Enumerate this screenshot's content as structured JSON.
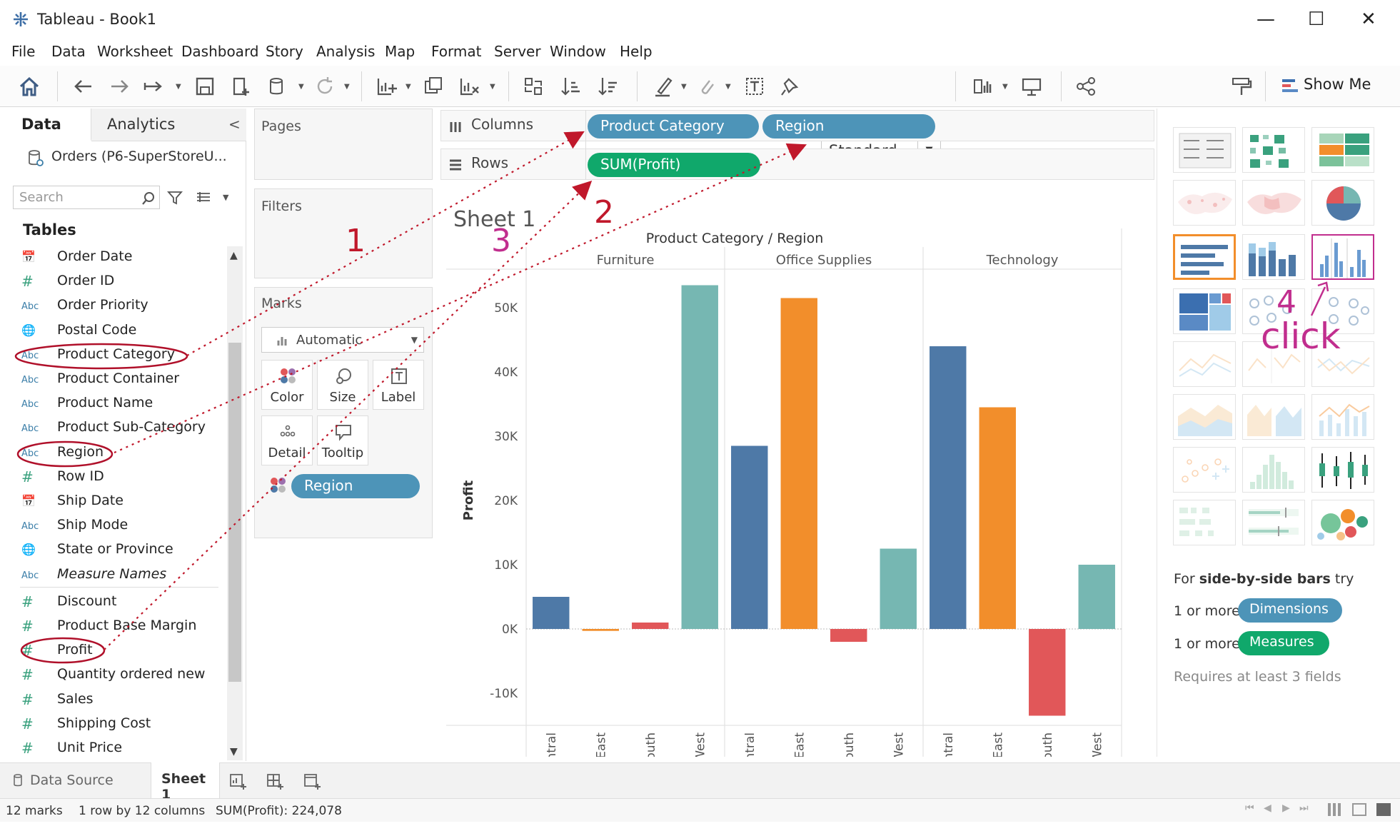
{
  "window": {
    "title": "Tableau - Book1",
    "min": "—",
    "max": "☐",
    "close": "✕"
  },
  "menu": [
    "File",
    "Data",
    "Worksheet",
    "Dashboard",
    "Story",
    "Analysis",
    "Map",
    "Format",
    "Server",
    "Window",
    "Help"
  ],
  "toolbar": {
    "fit_value": "Standard",
    "show_me_label": "Show Me"
  },
  "data_pane": {
    "tab_data": "Data",
    "tab_analytics": "Analytics",
    "collapse": "<",
    "datasource": "Orders (P6-SuperStoreU...",
    "search_placeholder": "Search",
    "tables_heading": "Tables",
    "fields": [
      {
        "type": "date",
        "icon": "📅",
        "name": "Order Date"
      },
      {
        "type": "num",
        "icon": "#",
        "name": "Order ID"
      },
      {
        "type": "str",
        "icon": "Abc",
        "name": "Order Priority"
      },
      {
        "type": "geo",
        "icon": "🌐",
        "name": "Postal Code"
      },
      {
        "type": "str",
        "icon": "Abc",
        "name": "Product Category"
      },
      {
        "type": "str",
        "icon": "Abc",
        "name": "Product Container"
      },
      {
        "type": "str",
        "icon": "Abc",
        "name": "Product Name"
      },
      {
        "type": "str",
        "icon": "Abc",
        "name": "Product Sub-Category"
      },
      {
        "type": "str",
        "icon": "Abc",
        "name": "Region"
      },
      {
        "type": "num",
        "icon": "#",
        "name": "Row ID"
      },
      {
        "type": "date",
        "icon": "📅",
        "name": "Ship Date"
      },
      {
        "type": "str",
        "icon": "Abc",
        "name": "Ship Mode"
      },
      {
        "type": "geo",
        "icon": "🌐",
        "name": "State or Province"
      },
      {
        "type": "str",
        "icon": "Abc",
        "name": "Measure Names"
      },
      {
        "type": "num",
        "icon": "#",
        "name": "Discount"
      },
      {
        "type": "num",
        "icon": "#",
        "name": "Product Base Margin"
      },
      {
        "type": "num",
        "icon": "#",
        "name": "Profit"
      },
      {
        "type": "num",
        "icon": "#",
        "name": "Quantity ordered new"
      },
      {
        "type": "num",
        "icon": "#",
        "name": "Sales"
      },
      {
        "type": "num",
        "icon": "#",
        "name": "Shipping Cost"
      },
      {
        "type": "num",
        "icon": "#",
        "name": "Unit Price"
      }
    ]
  },
  "cards": {
    "pages": "Pages",
    "filters": "Filters",
    "marks": "Marks",
    "mark_type": "Automatic",
    "buttons": [
      "Color",
      "Size",
      "Label",
      "Detail",
      "Tooltip"
    ],
    "marks_pill": "Region"
  },
  "shelves": {
    "columns_label": "Columns",
    "rows_label": "Rows",
    "columns_pills": [
      "Product Category",
      "Region"
    ],
    "rows_pills": [
      "SUM(Profit)"
    ]
  },
  "sheet": {
    "title": "Sheet 1"
  },
  "annotations": {
    "a1": "1",
    "a2": "2",
    "a3": "3",
    "a4": "4",
    "click": "click"
  },
  "chart_data": {
    "type": "bar",
    "header": "Product Category / Region",
    "panes": [
      "Furniture",
      "Office Supplies",
      "Technology"
    ],
    "categories": [
      "Central",
      "East",
      "South",
      "West"
    ],
    "ylabel": "Profit",
    "ylim": [
      -15000,
      55000
    ],
    "yticks": [
      -10000,
      0,
      10000,
      20000,
      30000,
      40000,
      50000
    ],
    "ytick_labels": [
      "-10K",
      "0K",
      "10K",
      "20K",
      "30K",
      "40K",
      "50K"
    ],
    "colors": {
      "Central": "#4e79a7",
      "East": "#f28e2b",
      "South": "#e15759",
      "West": "#76b7b2"
    },
    "values": [
      [
        5000,
        -300,
        1000,
        53500
      ],
      [
        28500,
        51500,
        -2000,
        12500
      ],
      [
        44000,
        34500,
        -13500,
        10000
      ]
    ]
  },
  "show_me": {
    "hint_prefix": "For ",
    "hint_bold": "side-by-side bars",
    "hint_suffix": " try",
    "one_or_more_1": "1 or more",
    "dimensions": "Dimensions",
    "one_or_more_2": "1 or more",
    "measures": "Measures",
    "requires": "Requires at least 3 fields"
  },
  "tabs": {
    "data_source": "Data Source",
    "sheet1": "Sheet 1"
  },
  "status": {
    "marks": "12 marks",
    "dims": "1 row by 12 columns",
    "sum": "SUM(Profit): 224,078"
  }
}
